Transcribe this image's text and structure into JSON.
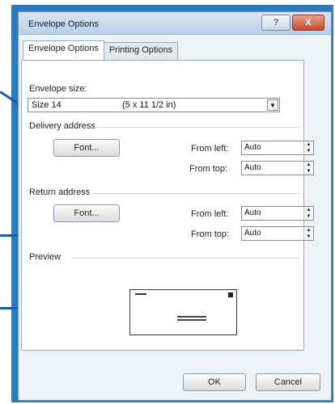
{
  "window": {
    "title": "Envelope Options",
    "help_label": "?",
    "close_label": "X"
  },
  "tabs": [
    {
      "label": "Envelope Options",
      "active": true
    },
    {
      "label": "Printing Options",
      "active": false
    }
  ],
  "envelope_size": {
    "label": "Envelope size:",
    "name": "Size 14",
    "dimensions": "(5 x 11 1/2 in)"
  },
  "delivery": {
    "heading": "Delivery address",
    "font_button": "Font...",
    "from_left_label": "From left:",
    "from_left_value": "Auto",
    "from_top_label": "From top:",
    "from_top_value": "Auto"
  },
  "return": {
    "heading": "Return address",
    "font_button": "Font...",
    "from_left_label": "From left:",
    "from_left_value": "Auto",
    "from_top_label": "From top:",
    "from_top_value": "Auto"
  },
  "preview": {
    "heading": "Preview"
  },
  "footer": {
    "ok_label": "OK",
    "cancel_label": "Cancel"
  },
  "colors": {
    "frame": "#2c79bd",
    "titlebar": "#c9dcf0",
    "close": "#c44a32"
  }
}
